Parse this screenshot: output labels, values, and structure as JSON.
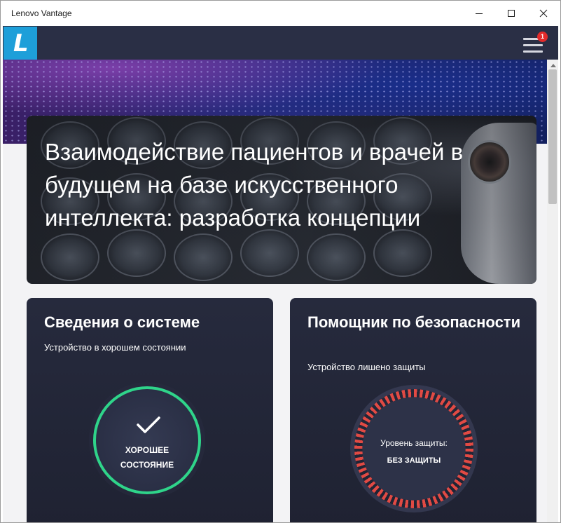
{
  "window": {
    "title": "Lenovo Vantage",
    "controls": {
      "minimize": "minimize-icon",
      "maximize": "maximize-icon",
      "close": "close-icon"
    }
  },
  "appbar": {
    "logo_letter": "L",
    "menu_badge": "1",
    "colors": {
      "bar": "#2a2f45",
      "logo": "#1e9fd9",
      "badge": "#e32b2b"
    }
  },
  "hero": {
    "title": "Взаимодействие пациентов и врачей в будущем на базе искусственного интеллекта: разработка концепции"
  },
  "system_card": {
    "title": "Сведения о системе",
    "subtitle": "Устройство в хорошем состоянии",
    "status_line1": "ХОРОШЕЕ",
    "status_line2": "СОСТОЯНИЕ",
    "status_color": "#2fd48a"
  },
  "security_card": {
    "title": "Помощник по безопасности",
    "subtitle": "Устройство лишено защиты",
    "level_label": "Уровень защиты:",
    "level_value": "БЕЗ ЗАЩИТЫ",
    "level_color": "#e14a44"
  }
}
